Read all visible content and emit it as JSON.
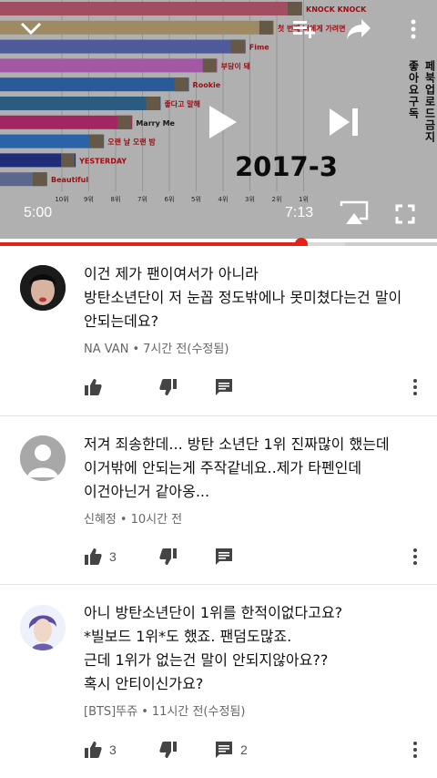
{
  "player": {
    "current_time": "5:00",
    "duration": "7:13",
    "progress": 0.69,
    "buffered": 0.79,
    "overlay_year": "2017-3",
    "side_text_right": "페북업로드금지",
    "side_text_left": "좋아요구독",
    "icons": {
      "collapse": "chevron-down-icon",
      "add_to_playlist": "playlist-add-icon",
      "share": "share-icon",
      "more": "more-vert-icon",
      "play": "play-icon",
      "next": "skip-next-icon",
      "cast": "cast-icon",
      "fullscreen": "fullscreen-icon"
    }
  },
  "chart_data": {
    "type": "bar",
    "categories": [
      "KNOCK KNOCK",
      "첫 번째 너에게 가려면",
      "Fime",
      "부담이 돼",
      "Rookie",
      "좋다고 말해",
      "Marry Me",
      "오랜 날 오랜 밤",
      "YESTERDAY",
      "Beautiful"
    ],
    "values": [
      1,
      2,
      3,
      4,
      5,
      6,
      7,
      8,
      9,
      10
    ],
    "tick_labels": [
      "10위",
      "9위",
      "8위",
      "7위",
      "6위",
      "5위",
      "4위",
      "3위",
      "2위",
      "1위"
    ],
    "colors": [
      "#e06c8a",
      "#dcc08a",
      "#6c7fd6",
      "#e27ae6",
      "#3a7dd6",
      "#3d7fb4",
      "#e2358a",
      "#3b8be6",
      "#2c3ea6",
      "#7f8fc4"
    ],
    "label_colors": [
      "#d8141c",
      "#d8141c",
      "#d8141c",
      "#d8141c",
      "#d8141c",
      "#d8141c",
      "#222222",
      "#d8141c",
      "#d8141c",
      "#d8141c"
    ],
    "grid": true
  },
  "comments": [
    {
      "text": "이건 제가 팬이여서가 아니라\n방탄소년단이 저 눈꼽 정도밖에나 못미쳤다는건 말이\n안되는데요?",
      "author": "NA VAN",
      "time": "7시간 전(수정됨)",
      "likes": "",
      "replies": ""
    },
    {
      "text": "저겨 죄송한데... 방탄 소년단 1위 진짜많이 했는데\n이거밖에 안되는게 주작같네요..제가 타펜인데\n이건아닌거 같아옹...",
      "author": "신혜정",
      "time": "10시간 전",
      "likes": "3",
      "replies": ""
    },
    {
      "text": "아니 방탄소년단이 1위를 한적이없다고요?\n*빌보드 1위*도 했죠. 팬덤도많죠.\n근데 1위가 없는건 말이 안되지않아요??\n혹시 안티이신가요?",
      "author": "[BTS]뚜쥬",
      "time": "11시간 전(수정됨)",
      "likes": "3",
      "replies": "2"
    }
  ],
  "comment_icons": {
    "like": "thumb-up-icon",
    "dislike": "thumb-down-icon",
    "reply": "reply-icon",
    "menu": "more-vert-icon"
  }
}
